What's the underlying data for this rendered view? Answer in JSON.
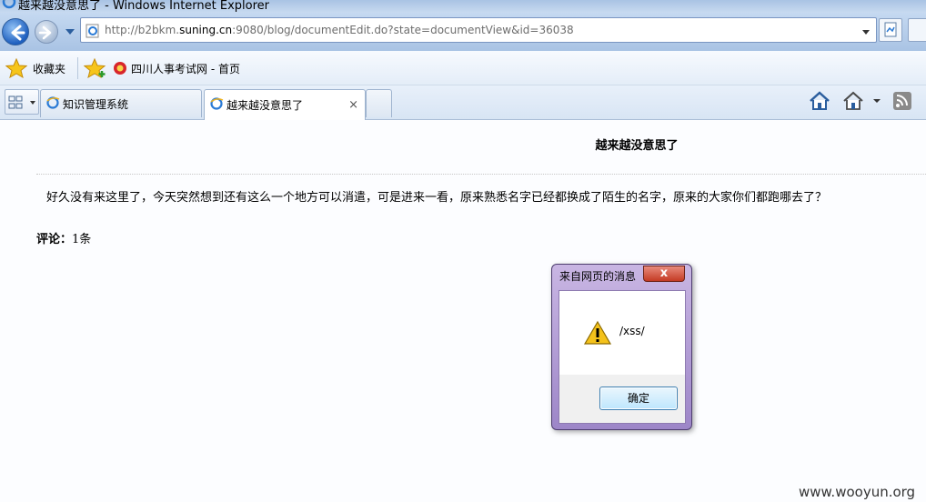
{
  "window": {
    "title": "越来越没意思了 - Windows Internet Explorer"
  },
  "address_bar": {
    "url_prefix": "http://b2bkm.",
    "url_domain": "suning.cn",
    "url_suffix": ":9080/blog/documentEdit.do?state=documentView&id=36038"
  },
  "favorites_bar": {
    "favorites_label": "收藏夹",
    "items": [
      {
        "label": "四川人事考试网 - 首页"
      }
    ]
  },
  "tabs": [
    {
      "label": "知识管理系统",
      "active": false
    },
    {
      "label": "越来越没意思了",
      "active": true,
      "close_glyph": "×"
    }
  ],
  "page": {
    "title": "越来越没意思了",
    "body": "好久没有来这里了，今天突然想到还有这么一个地方可以消遣，可是进来一看，原来熟悉名字已经都换成了陌生的名字，原来的大家你们都跑哪去了？",
    "comments_label": "评论：",
    "comments_count": "1条"
  },
  "dialog": {
    "title": "来自网页的消息",
    "close_glyph": "x",
    "message": "/xss/",
    "ok_label": "确定"
  },
  "watermark": "www.wooyun.org",
  "colors": {
    "dialog_frame": "#b4a0d6",
    "close_button": "#c43b24",
    "chrome_blue": "#a9c3e4"
  }
}
